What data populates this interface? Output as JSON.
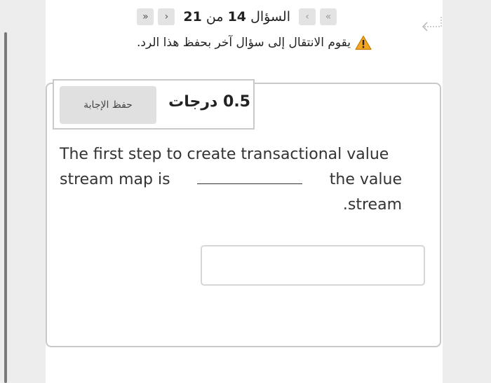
{
  "nav": {
    "prefix": "السؤال",
    "current": "14",
    "of_word": "من",
    "total": "21",
    "first_glyph": "«",
    "prev_glyph": "‹",
    "next_glyph": "›",
    "last_glyph": "»"
  },
  "warning": {
    "text": "يقوم الانتقال إلى سؤال آخر بحفظ هذا الرد.",
    "icon": "warning-icon",
    "icon_color": "#f5a623"
  },
  "question": {
    "points": "0.5 درجات",
    "save_label": "حفظ الإجابة",
    "line1": "The first step to create transactional value",
    "line2_start": "stream map is",
    "line2_end": "the value",
    "line3": ".stream",
    "answer_value": ""
  }
}
